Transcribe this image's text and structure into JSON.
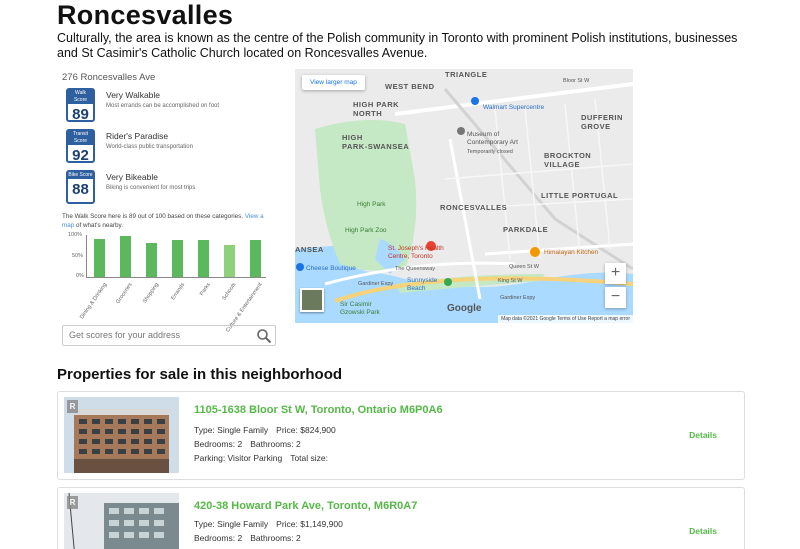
{
  "page": {
    "title": "Roncesvalles",
    "description": "Culturally, the area is known as the centre of the Polish community in Toronto with prominent Polish institutions, businesses and St Casimir's Catholic Church located on Roncesvalles Avenue."
  },
  "walkscore": {
    "address": "276 Roncesvalles Ave",
    "scores": [
      {
        "badge_label": "Walk Score",
        "value": "89",
        "name": "Very Walkable",
        "sub": "Most errands can be accomplished on foot"
      },
      {
        "badge_label": "Transit Score",
        "value": "92",
        "name": "Rider's Paradise",
        "sub": "World-class public transportation"
      },
      {
        "badge_label": "Bike Score",
        "value": "88",
        "name": "Very Bikeable",
        "sub": "Biking is convenient for most trips"
      }
    ],
    "note_text": "The Walk Score here is 89 out of 100 based on these categories.",
    "note_link": "View a map",
    "note_suffix": "of what's nearby.",
    "search_placeholder": "Get scores for your address"
  },
  "chart_data": {
    "type": "bar",
    "categories": [
      "Dining & Drinking",
      "Groceries",
      "Shopping",
      "Errands",
      "Parks",
      "Schools",
      "Culture & Entertainment"
    ],
    "values": [
      90,
      97,
      81,
      88,
      88,
      75,
      87
    ],
    "ylim": [
      0,
      100
    ],
    "yticks": [
      "100%",
      "50%",
      "0%"
    ],
    "colors": [
      "#5cb85c",
      "#5cb85c",
      "#5cb85c",
      "#5cb85c",
      "#5cb85c",
      "#8fd17a",
      "#5cb85c"
    ]
  },
  "map": {
    "larger_map_label": "View larger map",
    "labels": {
      "triangle": "TRIANGLE",
      "west_bend": "WEST BEND",
      "high_park_north": "HIGH PARK\nNORTH",
      "high_park_swansea": "HIGH\nPARK-SWANSEA",
      "roncesvalles": "RONCESVALLES",
      "brockton": "BROCKTON\nVILLAGE",
      "little_portugal": "LITTLE PORTUGAL",
      "dufferin": "DUFFERIN\nGROVE",
      "parkdale": "PARKDALE",
      "swansea": "ANSEA",
      "walmart": "Walmart Supercentre",
      "museum": "Museum of\nContemporary Art",
      "museum_sub": "Temporarily closed",
      "high_park": "High Park",
      "high_park_zoo": "High Park Zoo",
      "st_josephs": "St. Joseph's Health\nCentre, Toronto",
      "cheese": "Cheese Boutique",
      "himalayan": "Himalayan Kitchen",
      "sunnyside": "Sunnyside\nBeach",
      "sir_casimir": "Sir Casimir\nGzowski Park",
      "bloor": "Bloor St W",
      "queen": "Queen St W",
      "gardiner": "Gardiner Expy",
      "queensway": "The Queensway",
      "king": "King St W"
    },
    "footer": "Map data ©2021 Google   Terms of Use   Report a map error",
    "google": "Google",
    "zoom_in": "+",
    "zoom_out": "−"
  },
  "section_title": "Properties for sale in this neighborhood",
  "listings": [
    {
      "address": "1105-1638 Bloor St W, Toronto, Ontario M6P0A6",
      "type": "Type: Single Family",
      "price": "Price: $824,900",
      "bedrooms": "Bedrooms: 2",
      "bathrooms": "Bathrooms: 2",
      "parking": "Parking: Visitor Parking",
      "size": "Total size:",
      "details": "Details",
      "logo": "R"
    },
    {
      "address": "420-38 Howard Park Ave, Toronto, M6R0A7",
      "type": "Type: Single Family",
      "price": "Price: $1,149,900",
      "bedrooms": "Bedrooms: 2",
      "bathrooms": "Bathrooms: 2",
      "details": "Details",
      "logo": "R"
    }
  ]
}
